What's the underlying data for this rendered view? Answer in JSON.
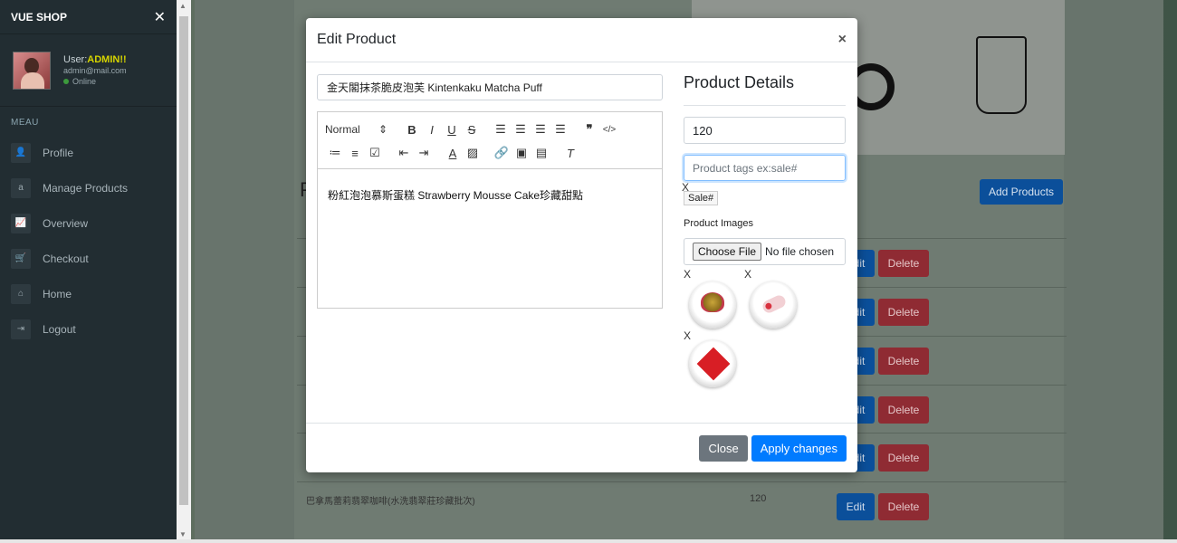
{
  "sidebar": {
    "brand": "VUE SHOP",
    "close_glyph": "✕",
    "user_prefix": "User:",
    "user_name": "ADMIN!!",
    "user_email": "admin@mail.com",
    "user_status": "Online",
    "menu_title": "MEAU",
    "items": [
      {
        "label": "Profile",
        "icon": "user-icon",
        "glyph": "👤"
      },
      {
        "label": "Manage Products",
        "icon": "amazon-icon",
        "glyph": "a"
      },
      {
        "label": "Overview",
        "icon": "line-chart-icon",
        "glyph": "📈"
      },
      {
        "label": "Checkout",
        "icon": "cart-icon",
        "glyph": "🛒"
      },
      {
        "label": "Home",
        "icon": "home-icon",
        "glyph": "⌂"
      },
      {
        "label": "Logout",
        "icon": "logout-icon",
        "glyph": "⇥"
      }
    ]
  },
  "background": {
    "title_fragment": "P",
    "add_button": "Add Products",
    "edit_label": "Edit",
    "delete_label": "Delete",
    "last_row_text": "巴拿馬蕾莉翡翠咖啡(水洗翡翠莊珍藏批次)",
    "last_row_price": "120"
  },
  "modal": {
    "title": "Edit Product",
    "close_glyph": "×",
    "product_name": "金天閣抹茶脆皮泡芙 Kintenkaku Matcha Puff",
    "editor": {
      "format_select": "Normal",
      "content": "粉紅泡泡慕斯蛋糕 Strawberry Mousse Cake珍藏甜點"
    },
    "details_title": "Product Details",
    "price_value": "120",
    "tags_placeholder": "Product tags ex:sale#",
    "tag_remove": "X",
    "tags": [
      "Sale#"
    ],
    "images_label": "Product Images",
    "file_button": "Choose File",
    "file_status": "No file chosen",
    "image_remove": "X",
    "close_button": "Close",
    "apply_button": "Apply changes"
  },
  "colors": {
    "primary": "#007bff",
    "secondary": "#6c757d",
    "sidebar_bg": "#222d32",
    "user_name": "#d6d400"
  }
}
